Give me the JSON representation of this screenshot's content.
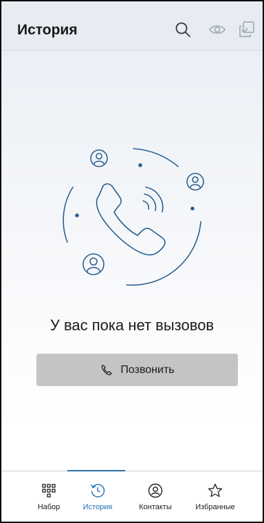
{
  "header": {
    "title": "История",
    "icons": [
      "search-icon",
      "eye-icon",
      "copy-check-icon"
    ]
  },
  "empty_state": {
    "message": "У вас пока нет вызовов",
    "button_label": "Позвонить",
    "illustration": "phone-with-contacts-illustration"
  },
  "bottom_nav": {
    "items": [
      {
        "label": "Набор",
        "icon": "dialpad-icon",
        "active": false
      },
      {
        "label": "История",
        "icon": "history-icon",
        "active": true
      },
      {
        "label": "Контакты",
        "icon": "contacts-icon",
        "active": false
      },
      {
        "label": "Избранные",
        "icon": "star-icon",
        "active": false
      }
    ]
  },
  "colors": {
    "accent": "#1f6fb5",
    "illustration": "#2a5f8f",
    "button_bg": "#c4c4c4",
    "header_bg": "#e7ebf2"
  }
}
